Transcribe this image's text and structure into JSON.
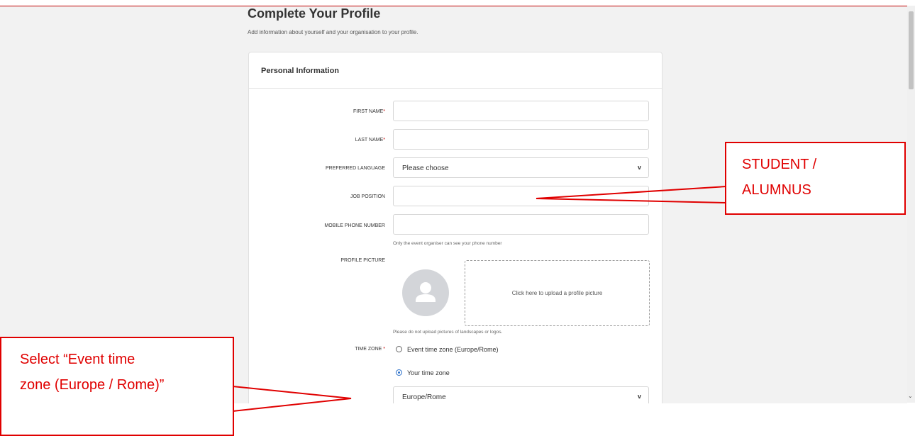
{
  "page": {
    "title": "Complete Your Profile",
    "subtitle": "Add information about yourself and your organisation to your profile."
  },
  "card": {
    "title": "Personal Information",
    "fields": {
      "first_name": {
        "label": "FIRST NAME",
        "required": "*",
        "value": ""
      },
      "last_name": {
        "label": "LAST NAME",
        "required": "*",
        "value": ""
      },
      "preferred_language": {
        "label": "PREFERRED LANGUAGE",
        "value": "Please choose"
      },
      "job_position": {
        "label": "JOB POSITION",
        "value": ""
      },
      "mobile_phone": {
        "label": "MOBILE PHONE NUMBER",
        "value": "",
        "hint": "Only the event organiser can see your phone number"
      },
      "profile_picture": {
        "label": "PROFILE PICTURE",
        "upload_text": "Click here to upload a profile picture",
        "hint": "Please do not upload pictures of landscapes or logos."
      },
      "time_zone": {
        "label": "TIME ZONE",
        "required": "*",
        "options": [
          "Event time zone (Europe/Rome)",
          "Your time zone"
        ],
        "selected_index": 1,
        "select_value": "Europe/Rome"
      }
    }
  },
  "icons": {
    "chevron": "v",
    "avatar": "user-silhouette-icon",
    "scroll_down": "chevron-down-icon"
  },
  "callouts": {
    "job": {
      "lines": [
        "STUDENT /",
        "ALUMNUS"
      ]
    },
    "timezone": {
      "lines": [
        "Select “Event time",
        "zone (Europe / Rome)”"
      ]
    }
  },
  "colors": {
    "annotation": "#e00000",
    "radio_selected": "#2a6fc9",
    "required_mark": "#c00000"
  }
}
